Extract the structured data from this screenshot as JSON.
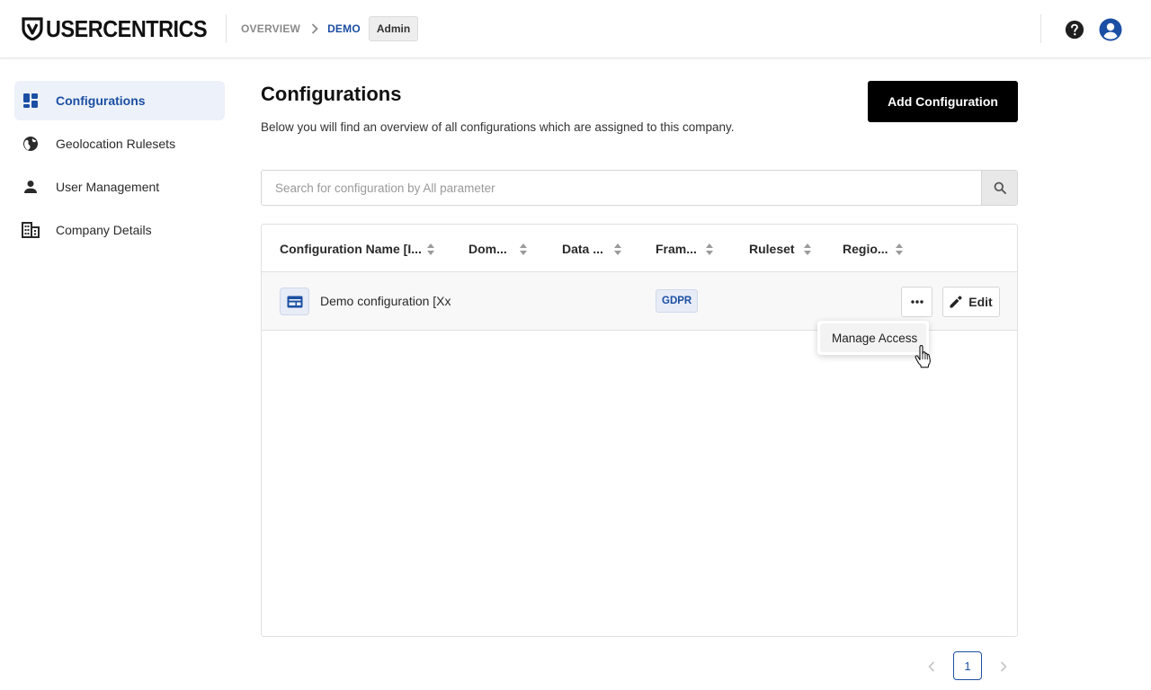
{
  "header": {
    "brand": "USERCENTRICS",
    "breadcrumb": {
      "overview": "OVERVIEW",
      "current": "DEMO",
      "role_badge": "Admin"
    },
    "help_icon": "help-circle-icon",
    "account_icon": "account-circle-icon"
  },
  "sidebar": {
    "items": [
      {
        "label": "Configurations",
        "icon": "dashboard-icon",
        "active": true
      },
      {
        "label": "Geolocation Rulesets",
        "icon": "globe-icon",
        "active": false
      },
      {
        "label": "User Management",
        "icon": "person-icon",
        "active": false
      },
      {
        "label": "Company Details",
        "icon": "building-icon",
        "active": false
      }
    ]
  },
  "main": {
    "title": "Configurations",
    "description": "Below you will find an overview of all configurations which are assigned to this company.",
    "add_button": "Add Configuration",
    "search": {
      "placeholder": "Search for configuration by All parameter",
      "value": ""
    },
    "table": {
      "columns": [
        "Configuration Name [I...",
        "Dom...",
        "Data ...",
        "Fram...",
        "Ruleset",
        "Regio..."
      ],
      "rows": [
        {
          "name": "Demo configuration [Xx",
          "domain": "",
          "data": "",
          "framework": "GDPR",
          "ruleset": "",
          "region": "",
          "edit_label": "Edit"
        }
      ]
    },
    "row_menu": {
      "items": [
        "Manage Access"
      ]
    },
    "pagination": {
      "current_page": "1"
    }
  },
  "colors": {
    "accent": "#1b4fa3",
    "active_bg": "#edf1f9",
    "primary_button": "#000000"
  }
}
